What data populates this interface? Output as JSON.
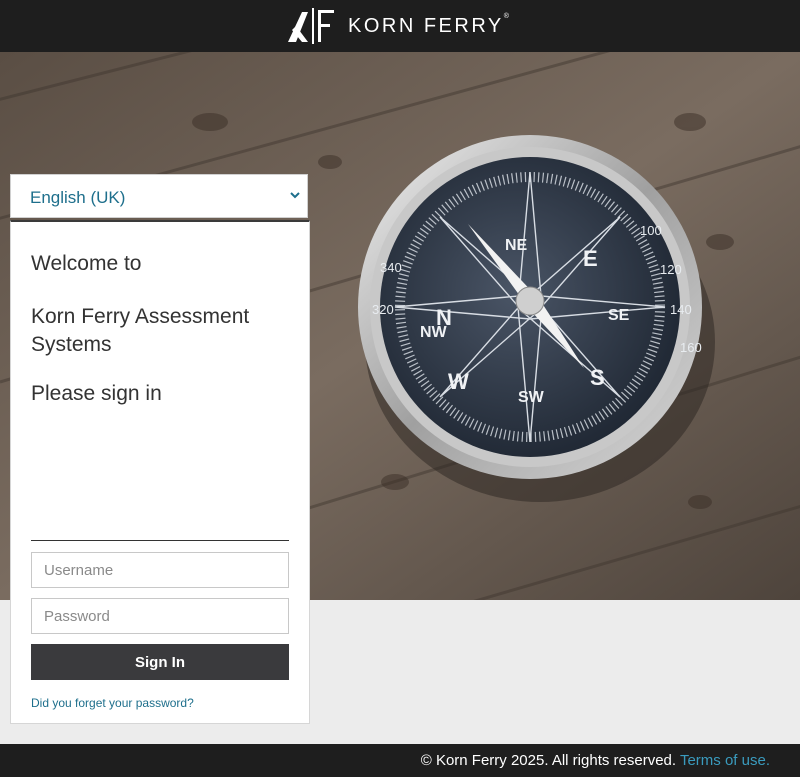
{
  "header": {
    "brand": "KORN FERRY",
    "registered_mark": "®"
  },
  "language": {
    "selected": "English (UK)"
  },
  "card": {
    "welcome": "Welcome to",
    "system_name": "Korn Ferry Assessment Systems",
    "signin_prompt": "Please sign in",
    "username_placeholder": "Username",
    "password_placeholder": "Password",
    "signin_button": "Sign In",
    "forgot_link": "Did you forget your password?"
  },
  "footer": {
    "copyright": "© Korn Ferry 2025. All rights reserved.",
    "terms_link": "Terms of use."
  },
  "hero": {
    "compass_labels": [
      "N",
      "NE",
      "E",
      "SE",
      "S",
      "SW",
      "W",
      "NW"
    ],
    "dial_numbers": [
      "100",
      "120",
      "140",
      "160",
      "320",
      "340"
    ]
  },
  "colors": {
    "topbar": "#1e1e1e",
    "link": "#1e6f8c",
    "button": "#3a3a3d",
    "footer_link": "#3a9bbe"
  }
}
